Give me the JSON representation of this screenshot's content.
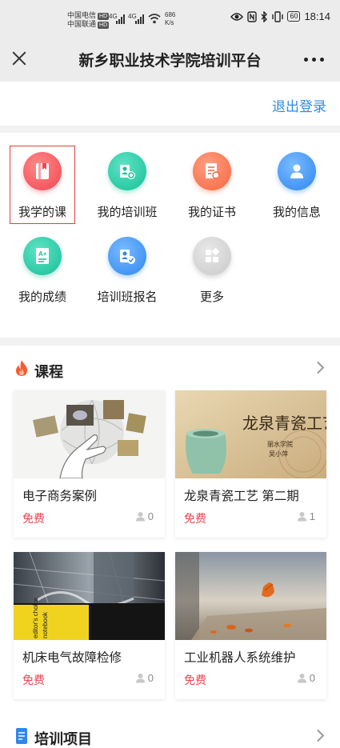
{
  "status_bar": {
    "carrier1": "中国电信",
    "carrier2": "中国联通",
    "hd": "HD",
    "net1": "4G",
    "net2": "4G",
    "speed_value": "686",
    "speed_unit": "K/s",
    "battery": "60",
    "time": "18:14"
  },
  "header": {
    "title": "新乡职业技术学院培训平台"
  },
  "account": {
    "logout": "退出登录"
  },
  "menu": [
    {
      "label": "我学的课",
      "icon": "book-icon",
      "color": "#f0454f",
      "selected": true
    },
    {
      "label": "我的培训班",
      "icon": "class-icon",
      "color": "#17bf98",
      "selected": false
    },
    {
      "label": "我的证书",
      "icon": "certificate-icon",
      "color": "#f6643e",
      "selected": false
    },
    {
      "label": "我的信息",
      "icon": "user-icon",
      "color": "#2f86f0",
      "selected": false
    },
    {
      "label": "我的成绩",
      "icon": "grade-icon",
      "color": "#17bf98",
      "selected": false
    },
    {
      "label": "培训班报名",
      "icon": "enroll-icon",
      "color": "#2f86f0",
      "selected": false
    },
    {
      "label": "更多",
      "icon": "more-grid-icon",
      "color": "#c9c9c9",
      "selected": false
    }
  ],
  "courses": {
    "title": "课程",
    "items": [
      {
        "title": "电子商务案例",
        "price": "免费",
        "learners": "0"
      },
      {
        "title": "龙泉青瓷工艺 第二期",
        "price": "免费",
        "learners": "1"
      },
      {
        "title": "机床电气故障检修",
        "price": "免费",
        "learners": "0"
      },
      {
        "title": "工业机器人系统维护",
        "price": "免费",
        "learners": "0"
      }
    ],
    "thumb_texts": {
      "celadon_caption": "龙泉青瓷工艺",
      "celadon_sub1": "丽水学院",
      "celadon_sub2": "吴小萍",
      "book_spine1": "editor's choice",
      "book_spine2": "notebook"
    }
  },
  "projects": {
    "title": "培训项目"
  }
}
